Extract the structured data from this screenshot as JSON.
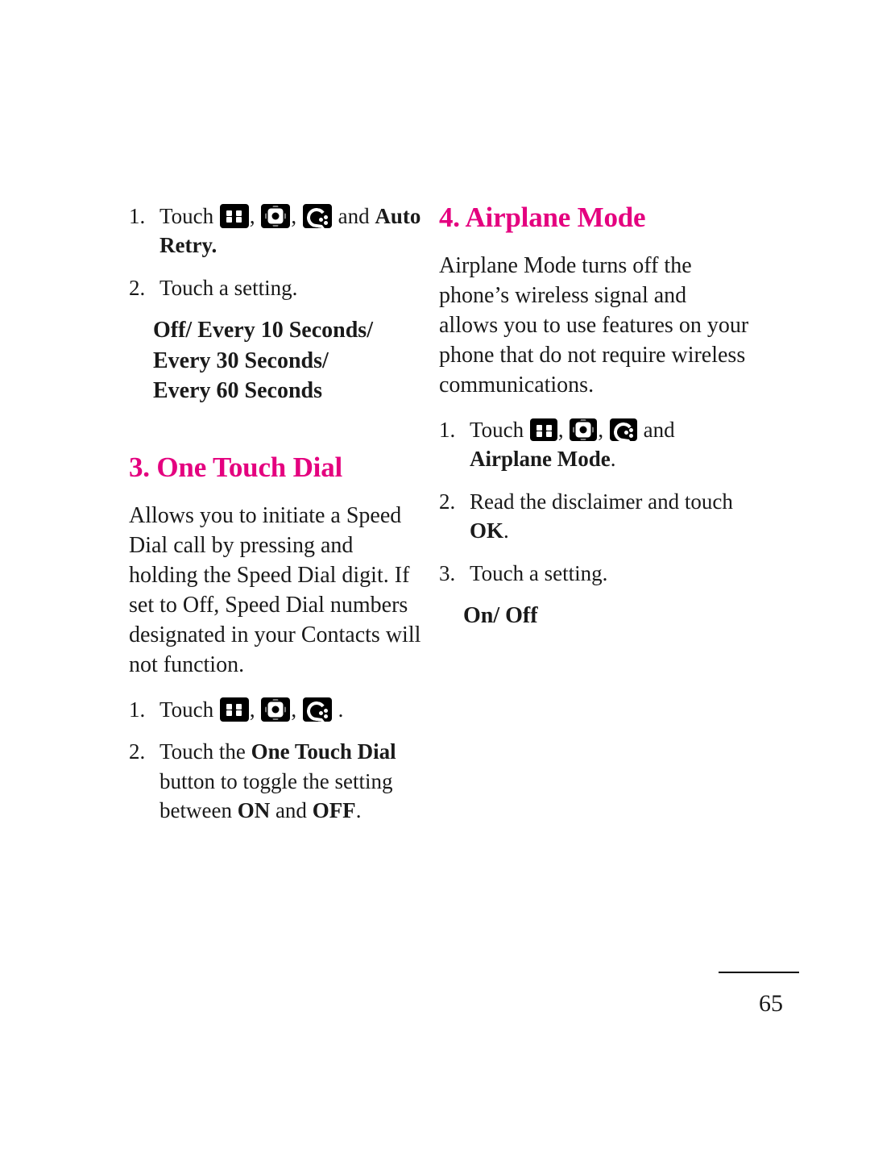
{
  "document": {
    "page_number": "65",
    "left_column": {
      "step1": {
        "num": "1.",
        "lead": "Touch",
        "sep": ",",
        "and": "and",
        "target": "Auto Retry",
        "period": "."
      },
      "step2": {
        "num": "2.",
        "text": "Touch a setting."
      },
      "options": [
        "Off/ Every 10 Seconds/",
        "Every 30 Seconds/",
        "Every 60 Seconds"
      ],
      "section_heading": "3. One Touch Dial",
      "section_body": "Allows you to initiate a Speed Dial call by pressing and holding the Speed Dial digit. If set to Off, Speed Dial numbers designated in your Contacts will not function.",
      "step3": {
        "num": "1.",
        "lead": "Touch",
        "sep": ",",
        "period": "."
      },
      "step4": {
        "num": "2.",
        "pre": "Touch the",
        "bold1": "One Touch Dial",
        "mid": "button to toggle the setting between",
        "bold2": "ON",
        "conj": "and",
        "bold3": "OFF",
        "period": "."
      }
    },
    "right_column": {
      "section_heading": "4. Airplane Mode",
      "section_body": "Airplane Mode turns off the phone’s wireless signal and allows you to use features on your phone that do not require wireless communications.",
      "step1": {
        "num": "1.",
        "lead": "Touch",
        "sep": ",",
        "and": "and",
        "target": "Airplane Mode",
        "period": "."
      },
      "step2": {
        "num": "2.",
        "pre": "Read the disclaimer and touch",
        "bold": "OK",
        "period": "."
      },
      "step3": {
        "num": "3.",
        "text": "Touch a setting."
      },
      "options": [
        "On/ Off"
      ]
    },
    "colors": {
      "heading": "#e4007f",
      "text": "#1a1a1a",
      "background": "#ffffff"
    }
  }
}
